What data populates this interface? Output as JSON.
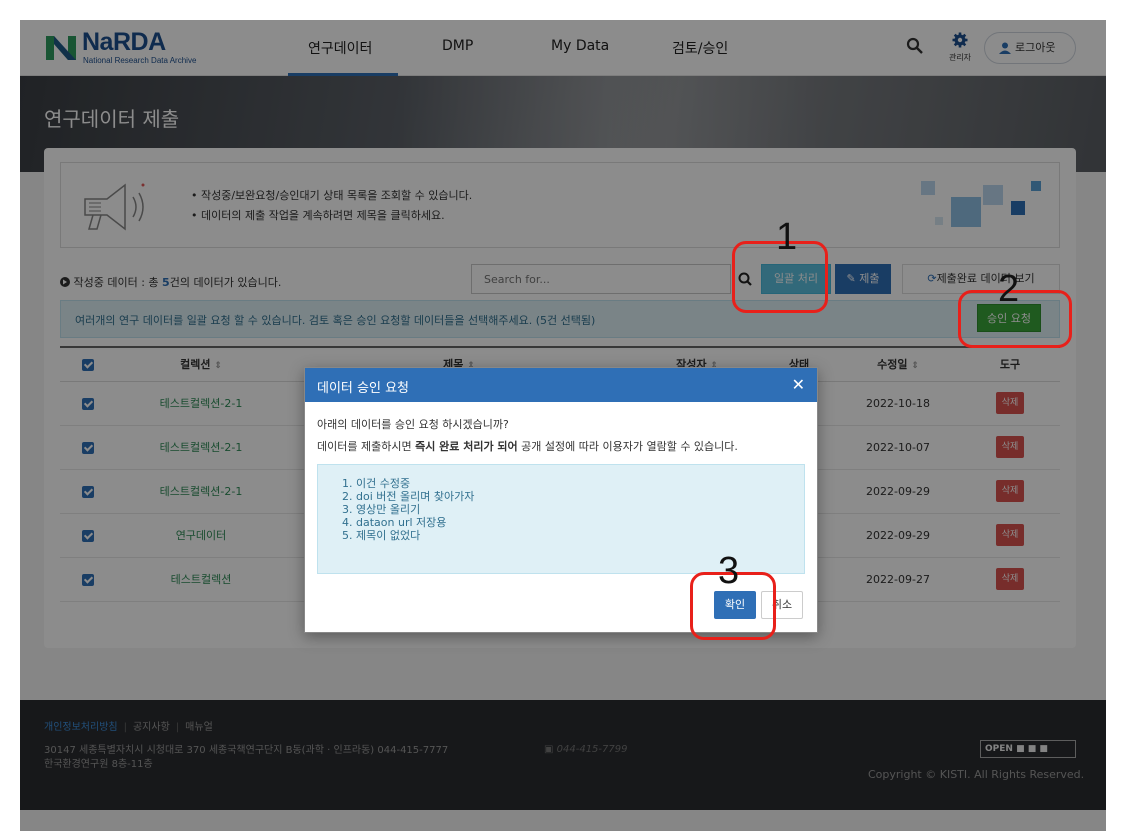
{
  "header": {
    "logo_text": "NaRDA",
    "logo_sub": "National Research Data Archive",
    "nav": [
      "연구데이터",
      "DMP",
      "My Data",
      "검토/승인"
    ],
    "admin_label": "관리자",
    "logout_label": "로그아웃"
  },
  "hero": {
    "title": "연구데이터 제출"
  },
  "guide": {
    "lines": [
      "• 작성중/보완요청/승인대기 상태 목록을 조회할 수 있습니다.",
      "• 데이터의 제출 작업을 계속하려면 제목을 클릭하세요."
    ]
  },
  "toolbar": {
    "count_prefix": "작성중 데이터 : 총 ",
    "count_num": "5",
    "count_suffix": "건의 데이터가 있습니다.",
    "search_placeholder": "Search for...",
    "bulk_label": "일괄 처리",
    "submit_label": "제출",
    "view_done_label": "제출완료 데이터 보기"
  },
  "info": {
    "text": "여러개의 연구 데이터를 일괄 요청 할 수 있습니다. 검토 혹은 승인 요청할 데이터들을 선택해주세요. (5건 선택됨)",
    "approve_label": "승인 요청"
  },
  "table": {
    "headers": [
      "컬렉션",
      "제목",
      "작성자",
      "상태",
      "수정일",
      "도구"
    ],
    "rows": [
      {
        "collection": "테스트컬렉션-2-1",
        "date": "2022-10-18",
        "tool": "삭제"
      },
      {
        "collection": "테스트컬렉션-2-1",
        "date": "2022-10-07",
        "tool": "삭제"
      },
      {
        "collection": "테스트컬렉션-2-1",
        "date": "2022-09-29",
        "tool": "삭제"
      },
      {
        "collection": "연구데이터",
        "date": "2022-09-29",
        "tool": "삭제"
      },
      {
        "collection": "테스트컬렉션",
        "date": "2022-09-27",
        "tool": "삭제"
      }
    ]
  },
  "modal": {
    "title": "데이터 승인 요청",
    "question": "아래의 데이터를 승인 요청 하시겠습니까?",
    "note_pre": "데이터를 제출하시면 ",
    "note_bold": "즉시 완료 처리가 되어",
    "note_post": " 공개 설정에 따라 이용자가 열람할 수 있습니다.",
    "items": [
      "1. 이건 수정중",
      "2. doi 버전 올리며 찾아가자",
      "3. 영상만 올리기",
      "4. dataon url 저장용",
      "5. 제목이 없었다"
    ],
    "ok_label": "확인",
    "cancel_label": "취소"
  },
  "footer": {
    "links": [
      "개인정보처리방침",
      "공지사항",
      "매뉴얼"
    ],
    "address_line1": "30147 세종특별자치시 시청대로 370 세종국책연구단지 B동(과학 · 인프라동)  044-415-7777",
    "address_line2": "한국환경연구원 8층-11층",
    "fax": "044-415-7799",
    "open_badge": "OPEN",
    "copyright": "Copyright © KISTI. All Rights Reserved."
  },
  "annotations": [
    "1",
    "2",
    "3"
  ],
  "colors": {
    "primary": "#2f6fb6",
    "info": "#5bc0de",
    "success": "#3aa53a",
    "danger": "#d9534f",
    "annotation": "#e8201a"
  }
}
